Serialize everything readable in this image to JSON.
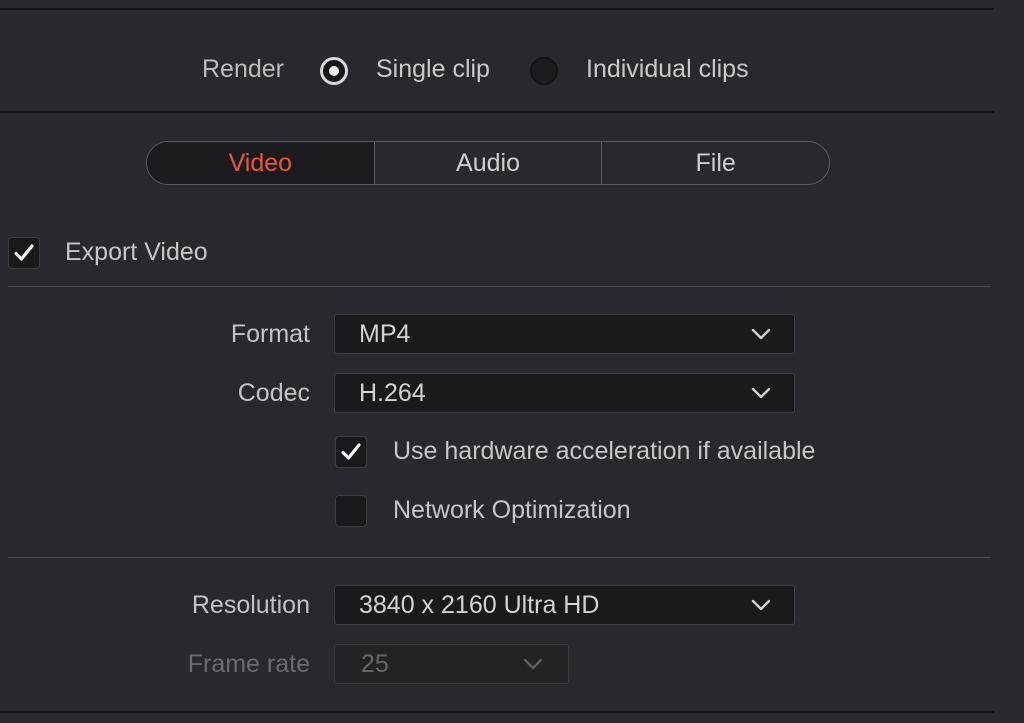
{
  "render": {
    "label": "Render",
    "options": [
      {
        "label": "Single clip",
        "selected": true
      },
      {
        "label": "Individual clips",
        "selected": false
      }
    ]
  },
  "tabs": [
    {
      "label": "Video",
      "active": true
    },
    {
      "label": "Audio",
      "active": false
    },
    {
      "label": "File",
      "active": false
    }
  ],
  "export_video": {
    "label": "Export Video",
    "checked": true
  },
  "format": {
    "label": "Format",
    "value": "MP4"
  },
  "codec": {
    "label": "Codec",
    "value": "H.264"
  },
  "hardware_accel": {
    "label": "Use hardware acceleration if available",
    "checked": true
  },
  "network_opt": {
    "label": "Network Optimization",
    "checked": false
  },
  "resolution": {
    "label": "Resolution",
    "value": "3840 x 2160 Ultra HD"
  },
  "frame_rate": {
    "label": "Frame rate",
    "value": "25",
    "disabled": true
  },
  "colors": {
    "accent": "#e8563e",
    "background": "#28282e",
    "field": "#1a1a1d"
  },
  "icons": [
    "checkmark-icon",
    "chevron-down-icon"
  ]
}
